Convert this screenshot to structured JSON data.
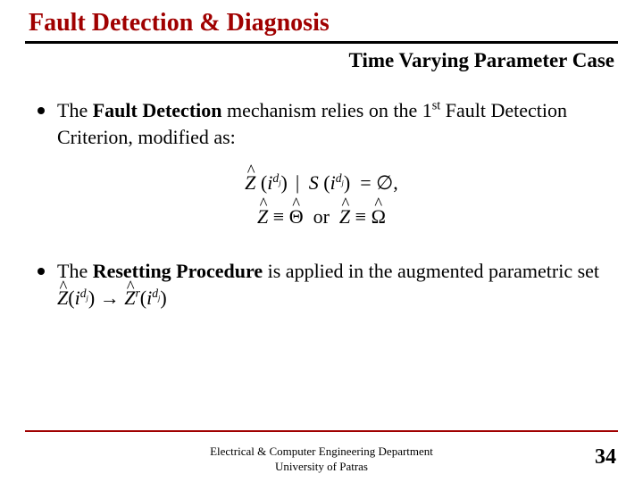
{
  "title": "Fault Detection & Diagnosis",
  "subtitle": "Time Varying Parameter Case",
  "bullet1": {
    "pre": "The ",
    "bold": "Fault Detection",
    "mid": " mechanism relies on the 1",
    "sup": "st",
    "post": " Fault Detection Criterion, modified as:"
  },
  "eq": {
    "line1_a": "Ẑ",
    "line1_exp": "d",
    "line1_sub": "j",
    "line1_mid": " |   S",
    "line1_end": " = ∅,",
    "line2_a": "Ẑ ≡ Θ̂  or  Ẑ ≡ Ω̂",
    "l1": "(i",
    "l2": ")"
  },
  "bullet2": {
    "pre": "The ",
    "bold": "Resetting Procedure",
    "post": " is applied in the augmented parametric set "
  },
  "inline": {
    "z": "Ẑ",
    "arrow": " → ",
    "zr": "Ẑ",
    "r": "r"
  },
  "footer": {
    "line1": "Electrical & Computer Engineering Department",
    "line2": "University of Patras"
  },
  "pagenum": "34"
}
